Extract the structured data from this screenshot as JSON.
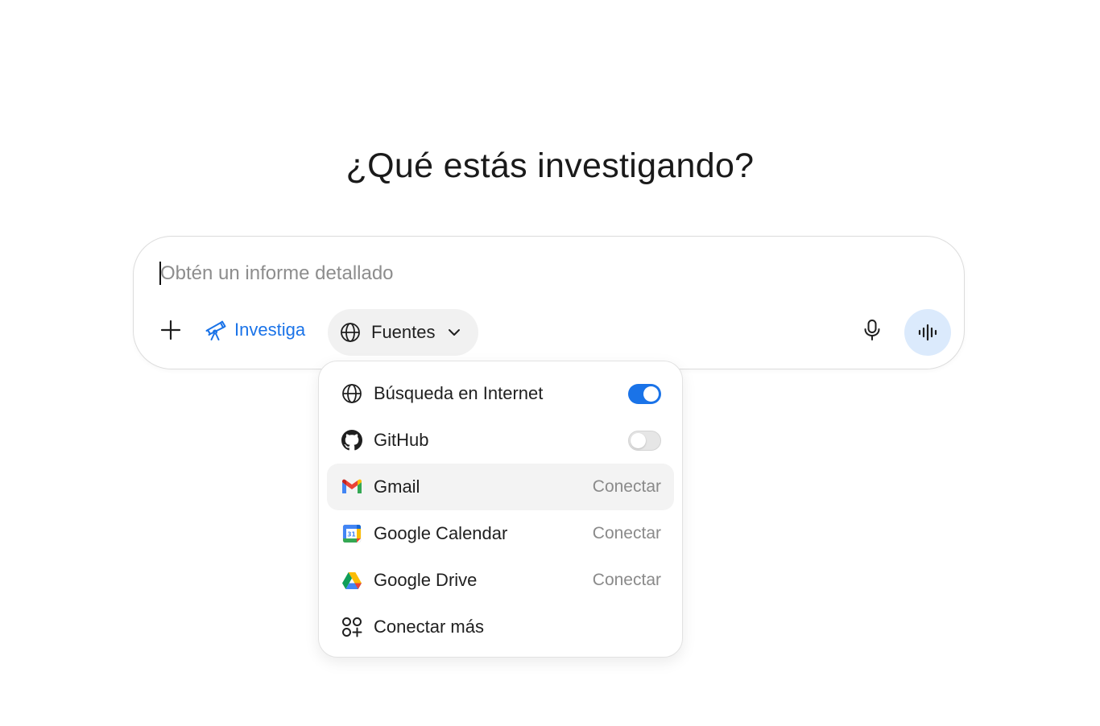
{
  "heading": "¿Qué estás investigando?",
  "composer": {
    "placeholder": "Obtén un informe detallado",
    "value": "",
    "mode_label": "Investiga",
    "sources_label": "Fuentes"
  },
  "icons": {
    "plus": "plus-icon",
    "mode": "telescope-icon",
    "sources": "globe-icon",
    "mic": "microphone-icon",
    "voice": "voice-waveform-icon"
  },
  "sources_menu": {
    "items": [
      {
        "label": "Búsqueda en Internet",
        "icon": "globe-icon",
        "control": "toggle",
        "enabled": true
      },
      {
        "label": "GitHub",
        "icon": "github-icon",
        "control": "toggle",
        "enabled": false
      },
      {
        "label": "Gmail",
        "icon": "gmail-icon",
        "action": "Conectar"
      },
      {
        "label": "Google Calendar",
        "icon": "google-calendar-icon",
        "action": "Conectar"
      },
      {
        "label": "Google Drive",
        "icon": "google-drive-icon",
        "action": "Conectar"
      },
      {
        "label": "Conectar más",
        "icon": "apps-plus-icon"
      }
    ]
  },
  "colors": {
    "accent": "#1a73e8",
    "voice_bg": "#dbeafc",
    "chip_bg": "#f1f1f1",
    "hover_bg": "#f3f3f3"
  }
}
